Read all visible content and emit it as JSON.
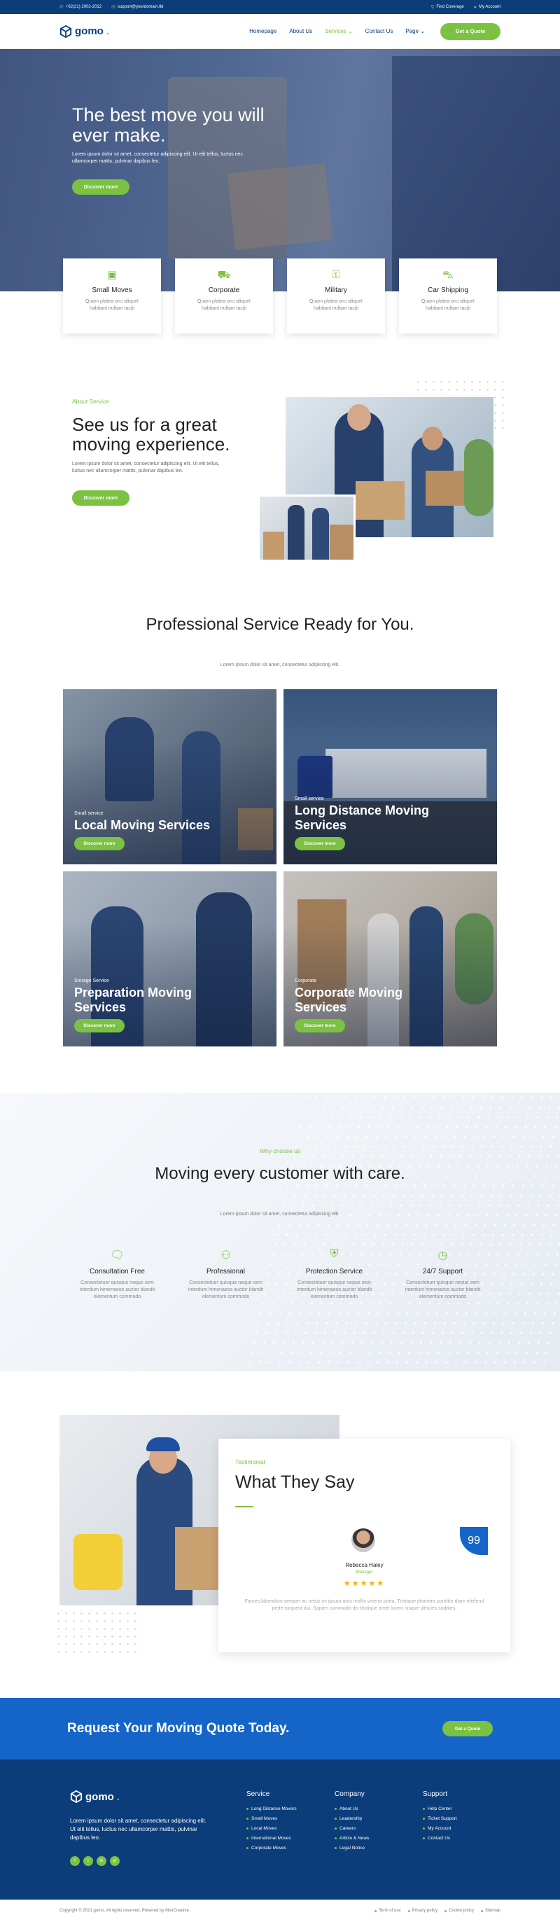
{
  "topbar": {
    "phone": "+62(21) 2002-2012",
    "email": "support@yourdomain.tld",
    "find_coverage": "Find Coverage",
    "my_account": "My Account"
  },
  "nav": {
    "logo": "gomo",
    "items": [
      "Homepage",
      "About Us",
      "Services",
      "Contact Us",
      "Page"
    ],
    "cta": "Get a Quote"
  },
  "hero": {
    "title": "The best move you will ever make.",
    "text": "Lorem ipsum dolor sit amet, consectetur adipiscing elit. Ut elit tellus, luctus nec ullamcorper mattis, pulvinar dapibus leo.",
    "button": "Discover more"
  },
  "features": [
    {
      "title": "Small Moves",
      "text": "Quam platea orci aliquet habitant nullam taciti",
      "icon": "box-icon"
    },
    {
      "title": "Corporate",
      "text": "Quam platea orci aliquet habitant nullam taciti",
      "icon": "truck-icon"
    },
    {
      "title": "Military",
      "text": "Quam platea orci aliquet habitant nullam taciti",
      "icon": "key-icon"
    },
    {
      "title": "Car Shipping",
      "text": "Quam platea orci aliquet habitant nullam taciti",
      "icon": "car-icon"
    }
  ],
  "about": {
    "tag": "About Service",
    "title": "See us for a great moving experience.",
    "text": "Lorem ipsum dolor sit amet, consectetur adipiscing elit. Ut elit tellus, luctus nec ullamcorper mattis, pulvinar dapibus leo.",
    "button": "Discover more"
  },
  "services": {
    "title": "Professional Service Ready for You.",
    "subtitle": "Lorem ipsum dolor sit amet, consectetur adipiscing elit.",
    "items": [
      {
        "kicker": "Small service",
        "title": "Local Moving Services",
        "button": "Discover more"
      },
      {
        "kicker": "Small service",
        "title": "Long Distance Moving Services",
        "button": "Discover more"
      },
      {
        "kicker": "Storage Service",
        "title": "Preparation Moving Services",
        "button": "Discover more"
      },
      {
        "kicker": "Corporate",
        "title": "Corporate Moving Services",
        "button": "Discover more"
      }
    ]
  },
  "why": {
    "tag": "Why choose us",
    "title": "Moving every customer with care.",
    "subtitle": "Lorem ipsum dolor sit amet, consectetur adipiscing elit.",
    "items": [
      {
        "title": "Consultation Free",
        "text": "Consectetuer quisque neque sem interdum himenaeos auctor blandit elementum commodo",
        "icon": "chat-icon"
      },
      {
        "title": "Professional",
        "text": "Consectetuer quisque neque sem interdum himenaeos auctor blandit elementum commodo",
        "icon": "network-icon"
      },
      {
        "title": "Protection Service",
        "text": "Consectetuer quisque neque sem interdum himenaeos auctor blandit elementum commodo",
        "icon": "shield-icon"
      },
      {
        "title": "24/7 Support",
        "text": "Consectetuer quisque neque sem interdum himenaeos auctor blandit elementum commodo",
        "icon": "clock-icon"
      }
    ]
  },
  "testimonial": {
    "tag": "Testimonial",
    "title": "What They Say",
    "name": "Rebecca Haley",
    "role": "Manager",
    "rating": 5,
    "stars": "★★★★★",
    "quote_mark": "99",
    "text": "Fames bibendum semper ac netus mi ipsum arcu mollis viverra porta. Tristique pharetra porttitor diam eleifend pede torquent dui. Sapien commodo dis tristique amet lorem nisque ultricies sodales."
  },
  "cta": {
    "title": "Request Your Moving Quote Today.",
    "button": "Get a Quote"
  },
  "footer": {
    "logo": "gomo",
    "desc": "Lorem ipsum dolor sit amet, consectetur adipiscing elit. Ut elit tellus, luctus nec ullamcorper mattis, pulvinar dapibus leo.",
    "socials": [
      "f",
      "t",
      "in",
      "yt"
    ],
    "columns": [
      {
        "title": "Service",
        "links": [
          "Long Distance Movers",
          "Small Moves",
          "Local Moves",
          "International Moves",
          "Corporate Moves"
        ]
      },
      {
        "title": "Company",
        "links": [
          "About Us",
          "Leadership",
          "Careers",
          "Article & News",
          "Legal Notice"
        ]
      },
      {
        "title": "Support",
        "links": [
          "Help Center",
          "Ticket Support",
          "My Account",
          "Contact Us"
        ]
      }
    ],
    "copyright": "Copyright © 2021 gomo, All rights reserved. Powered by MoxCreative.",
    "legal": [
      "Term of use",
      "Privacy policy",
      "Cookie policy",
      "Sitemap"
    ]
  },
  "colors": {
    "accent": "#7cc242",
    "primary": "#0a3d7a",
    "cta_blue": "#1565c9"
  }
}
